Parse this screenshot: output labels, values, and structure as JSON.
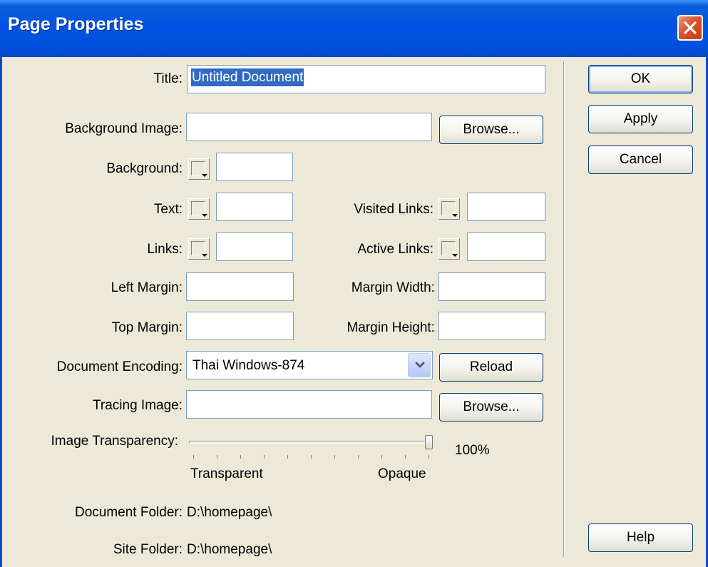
{
  "dialog": {
    "title": "Page Properties"
  },
  "fields": {
    "title_label": "Title:",
    "title_value": "Untitled Document",
    "background_image_label": "Background Image:",
    "background_image_value": "",
    "background_label": "Background:",
    "background_value": "",
    "text_label": "Text:",
    "text_value": "",
    "visited_links_label": "Visited Links:",
    "visited_links_value": "",
    "links_label": "Links:",
    "links_value": "",
    "active_links_label": "Active Links:",
    "active_links_value": "",
    "left_margin_label": "Left Margin:",
    "left_margin_value": "",
    "margin_width_label": "Margin Width:",
    "margin_width_value": "",
    "top_margin_label": "Top Margin:",
    "top_margin_value": "",
    "margin_height_label": "Margin Height:",
    "margin_height_value": "",
    "document_encoding_label": "Document Encoding:",
    "document_encoding_value": "Thai Windows-874",
    "tracing_image_label": "Tracing Image:",
    "tracing_image_value": ""
  },
  "transparency": {
    "label": "Image Transparency:",
    "value_text": "100%",
    "value": 100,
    "min_label": "Transparent",
    "max_label": "Opaque"
  },
  "info": {
    "document_folder_label": "Document Folder:",
    "document_folder_value": "D:\\homepage\\",
    "site_folder_label": "Site Folder:",
    "site_folder_value": "D:\\homepage\\"
  },
  "buttons": {
    "ok": "OK",
    "apply": "Apply",
    "cancel": "Cancel",
    "help": "Help",
    "browse_background": "Browse...",
    "reload": "Reload",
    "browse_tracing": "Browse..."
  },
  "colors": {
    "titlebar": "#0054e3",
    "dialog_bg": "#ece9d8",
    "selection": "#316ac5",
    "close_button": "#d8542c"
  },
  "icons": {
    "close": "close-icon",
    "dropdown": "chevron-down-icon",
    "color_picker": "color-swatch-icon"
  }
}
